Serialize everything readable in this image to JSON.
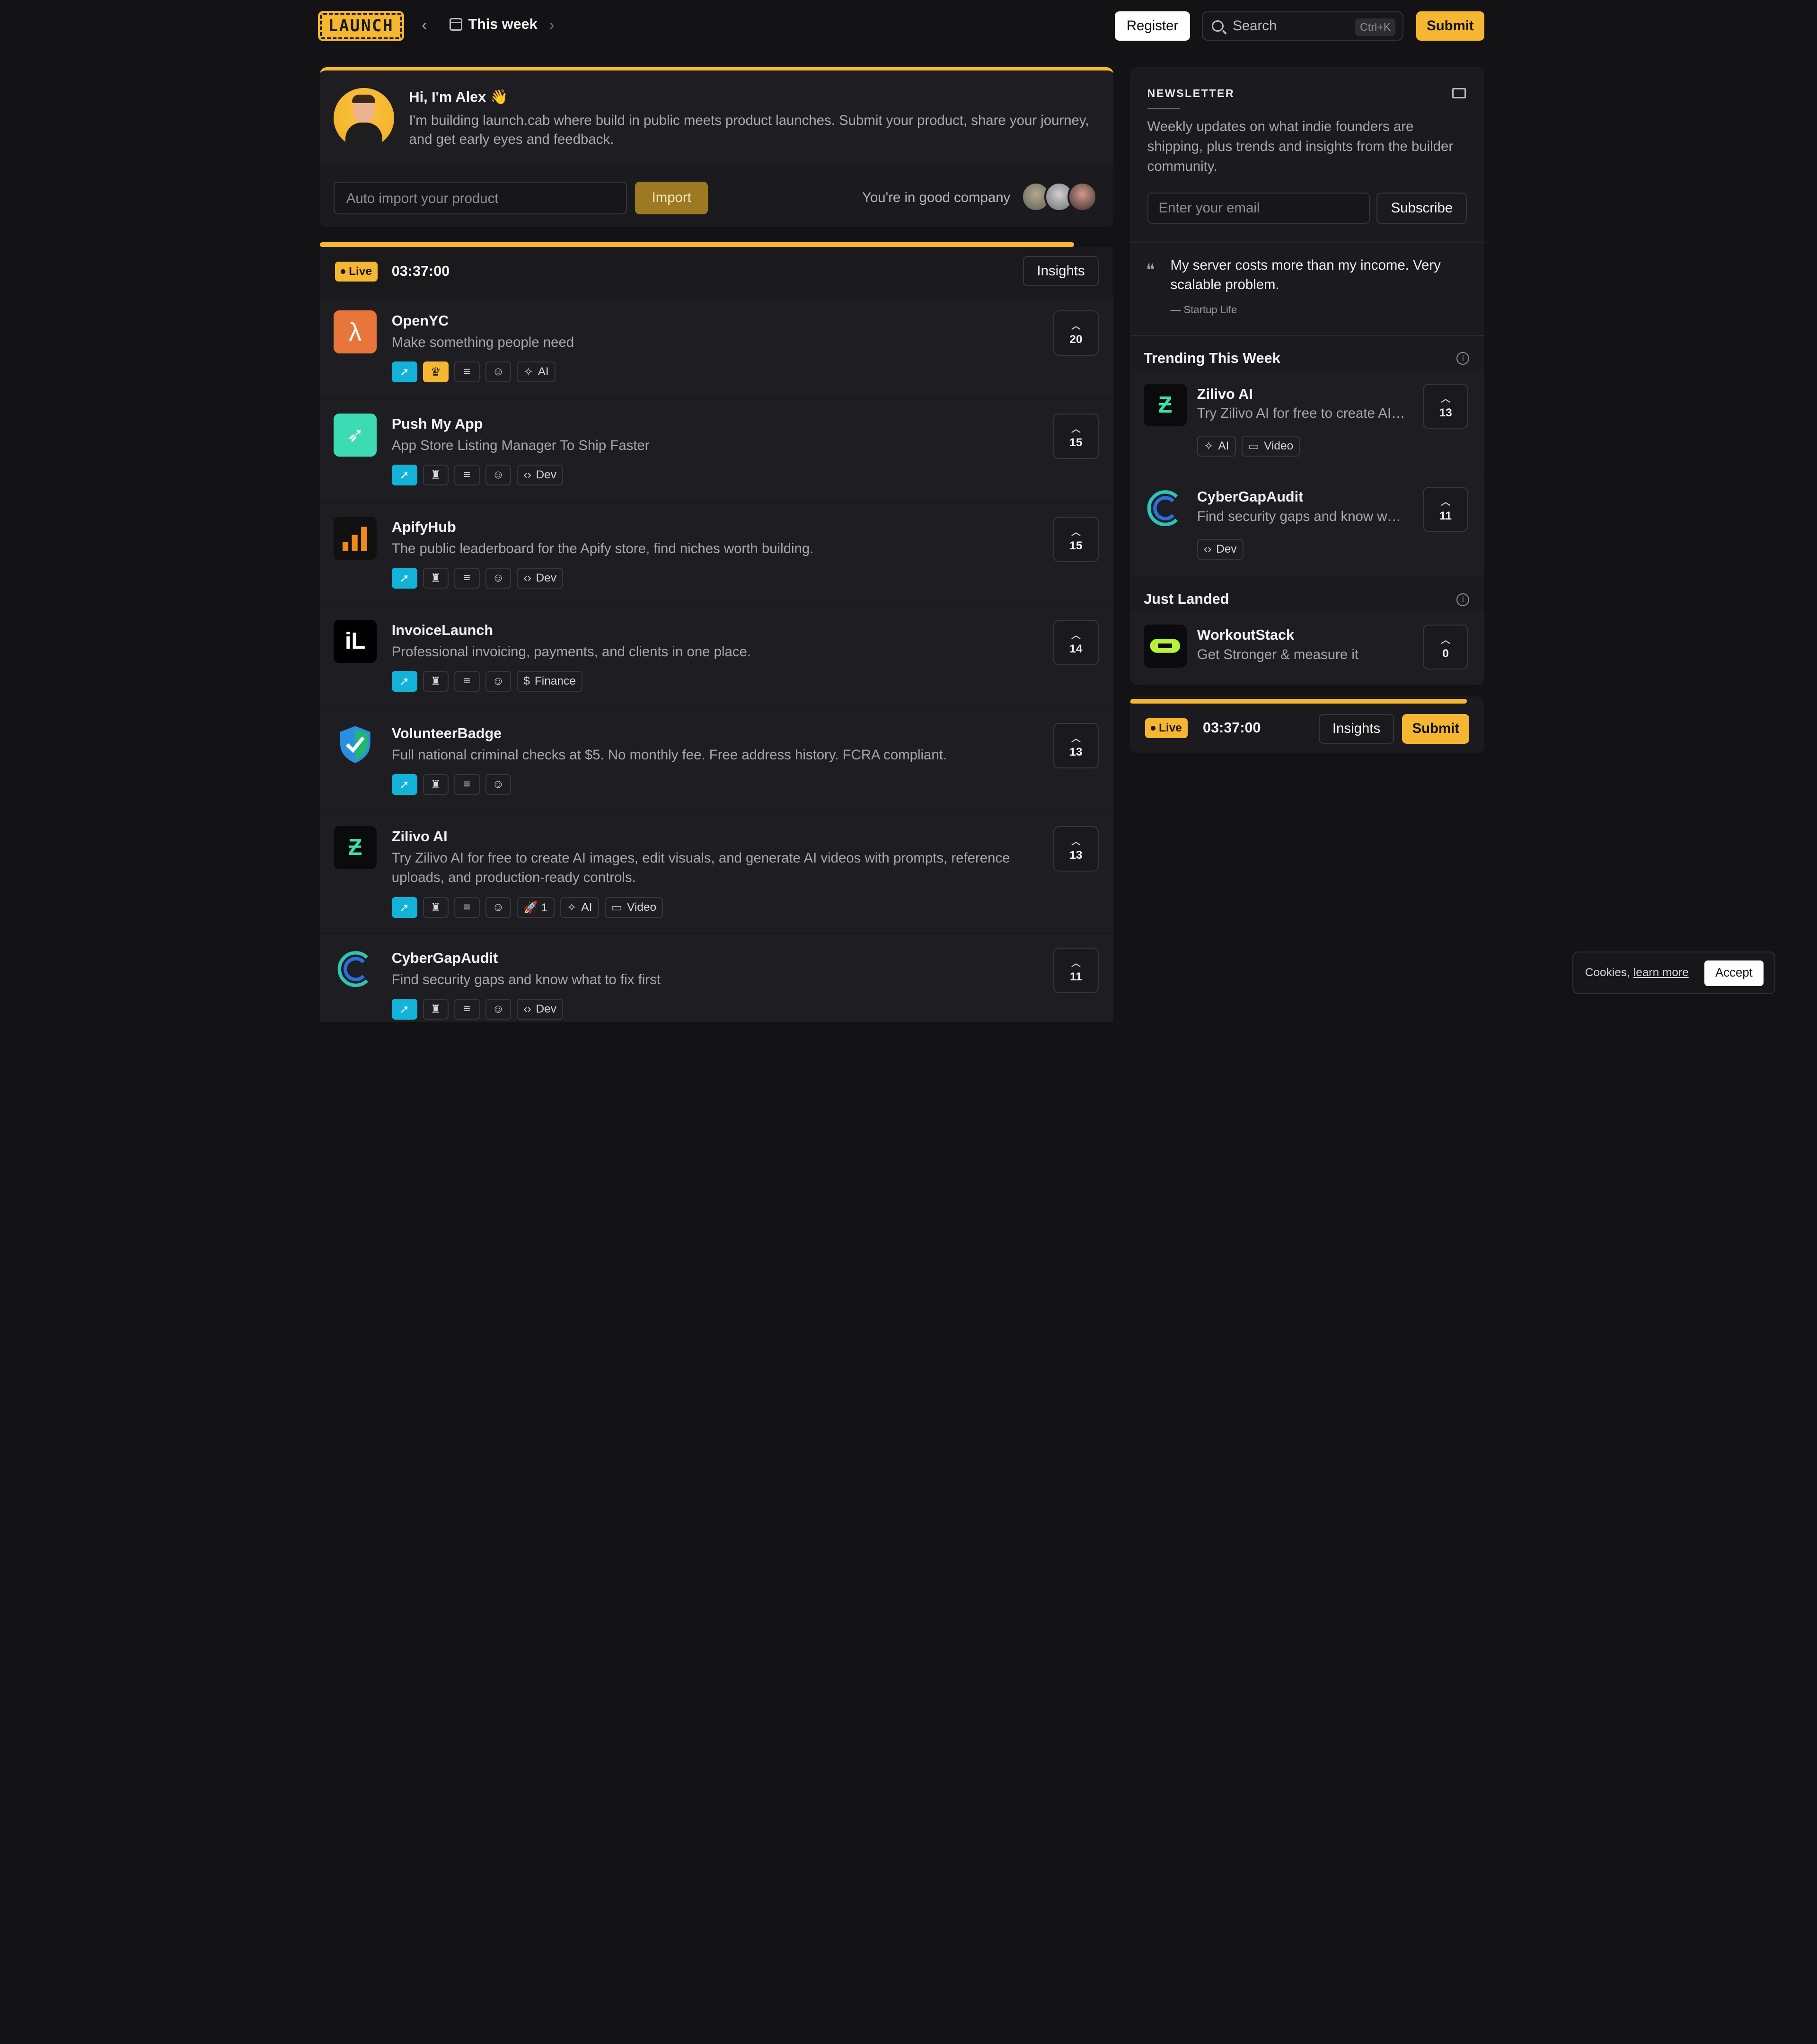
{
  "header": {
    "logo": "LAUNCH",
    "prev_label": "‹",
    "week_label": "This week",
    "next_label": "›",
    "register_label": "Register",
    "search_placeholder": "Search",
    "search_shortcut": "Ctrl+K",
    "submit_label": "Submit"
  },
  "intro": {
    "title": "Hi, I'm Alex 👋",
    "text": "I'm building launch.cab where build in public meets product launches. Submit your product, share your journey, and get early eyes and feedback.",
    "import_placeholder": "Auto import your product",
    "import_label": "Import",
    "company_label": "You're in good company"
  },
  "live": {
    "badge": "Live",
    "timer": "03:37:00",
    "insights_label": "Insights"
  },
  "products": [
    {
      "name": "OpenYC",
      "desc": "Make something people need",
      "votes": "20",
      "category": "AI",
      "logo": "lambda-icon"
    },
    {
      "name": "Push My App",
      "desc": "App Store Listing Manager To Ship Faster",
      "votes": "15",
      "category": "Dev",
      "logo": "rocket-icon"
    },
    {
      "name": "ApifyHub",
      "desc": "The public leaderboard for the Apify store, find niches worth building.",
      "votes": "15",
      "category": "Dev",
      "logo": "bar-chart-icon"
    },
    {
      "name": "InvoiceLaunch",
      "desc": "Professional invoicing, payments, and clients in one place.",
      "votes": "14",
      "category": "Finance",
      "logo": "il-icon"
    },
    {
      "name": "VolunteerBadge",
      "desc": "Full national criminal checks at $5. No monthly fee. Free address history. FCRA compliant.",
      "votes": "13",
      "category": "",
      "logo": "shield-icon"
    },
    {
      "name": "Zilivo AI",
      "desc": "Try Zilivo AI for free to create AI images, edit visuals, and generate AI videos with prompts, reference uploads, and production-ready controls.",
      "votes": "13",
      "category": "AI",
      "category2": "Video",
      "boost": "🚀 1",
      "logo": "z-icon"
    },
    {
      "name": "CyberGapAudit",
      "desc": "Find security gaps and know what to fix first",
      "votes": "11",
      "category": "Dev",
      "logo": "c-icon"
    }
  ],
  "sidebar": {
    "newsletter_label": "NEWSLETTER",
    "newsletter_desc": "Weekly updates on what indie founders are shipping, plus trends and insights from the builder community.",
    "email_placeholder": "Enter your email",
    "subscribe_label": "Subscribe",
    "quote": "My server costs more than my income. Very scalable problem.",
    "quote_source": "— Startup Life",
    "trending_title": "Trending This Week",
    "trending": [
      {
        "name": "Zilivo AI",
        "desc": "Try Zilivo AI for free to create AI images, edit visuals",
        "votes": "13",
        "tag1": "AI",
        "tag2": "Video"
      },
      {
        "name": "CyberGapAudit",
        "desc": "Find security gaps and know what to fix first",
        "votes": "11",
        "tag1": "Dev"
      }
    ],
    "landed_title": "Just Landed",
    "landed": [
      {
        "name": "WorkoutStack",
        "desc": "Get Stronger & measure it",
        "votes": "0"
      }
    ]
  },
  "live2": {
    "badge": "Live",
    "timer": "03:37:00",
    "insights_label": "Insights",
    "submit_label": "Submit"
  },
  "cookie": {
    "text": "Cookies,",
    "link": "learn more",
    "accept_label": "Accept"
  },
  "colors": {
    "accent": "#f5b731",
    "rocket_tag": "#13b3d9",
    "background": "#131316"
  }
}
